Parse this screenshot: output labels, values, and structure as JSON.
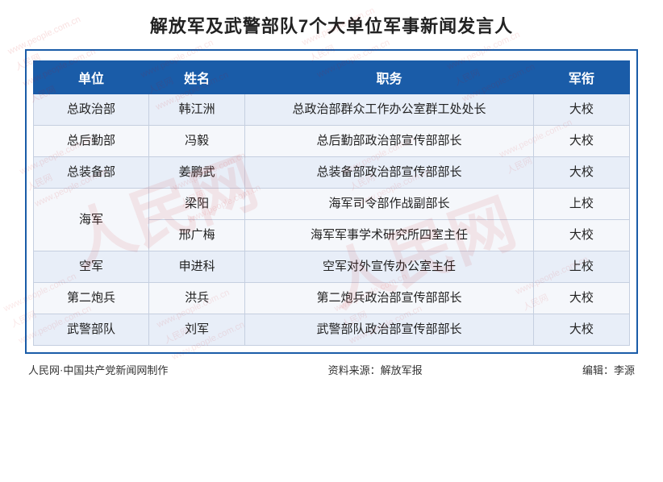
{
  "title": "解放军及武警部队7个大单位军事新闻发言人",
  "table": {
    "headers": [
      "单位",
      "姓名",
      "职务",
      "军衔"
    ],
    "rows": [
      {
        "unit": "总政治部",
        "name": "韩江洲",
        "title": "总政治部群众工作办公室群工处处长",
        "rank": "大校",
        "rowspan": 1
      },
      {
        "unit": "总后勤部",
        "name": "冯毅",
        "title": "总后勤部政治部宣传部部长",
        "rank": "大校",
        "rowspan": 1
      },
      {
        "unit": "总装备部",
        "name": "姜鹏武",
        "title": "总装备部政治部宣传部部长",
        "rank": "大校",
        "rowspan": 1
      },
      {
        "unit": "海军",
        "name": "梁阳",
        "title": "海军司令部作战副部长",
        "rank": "上校",
        "rowspan": 2,
        "isNavy": true,
        "navyRow": 1
      },
      {
        "unit": "",
        "name": "邢广梅",
        "title": "海军军事学术研究所四室主任",
        "rank": "大校",
        "rowspan": 0,
        "isNavy": true,
        "navyRow": 2
      },
      {
        "unit": "空军",
        "name": "申进科",
        "title": "空军对外宣传办公室主任",
        "rank": "上校",
        "rowspan": 1
      },
      {
        "unit": "第二炮兵",
        "name": "洪兵",
        "title": "第二炮兵政治部宣传部部长",
        "rank": "大校",
        "rowspan": 1
      },
      {
        "unit": "武警部队",
        "name": "刘军",
        "title": "武警部队政治部宣传部部长",
        "rank": "大校",
        "rowspan": 1
      }
    ]
  },
  "footer": {
    "left": "人民网·中国共产党新闻网制作",
    "center": "资料来源：解放军报",
    "right": "编辑：李源"
  }
}
